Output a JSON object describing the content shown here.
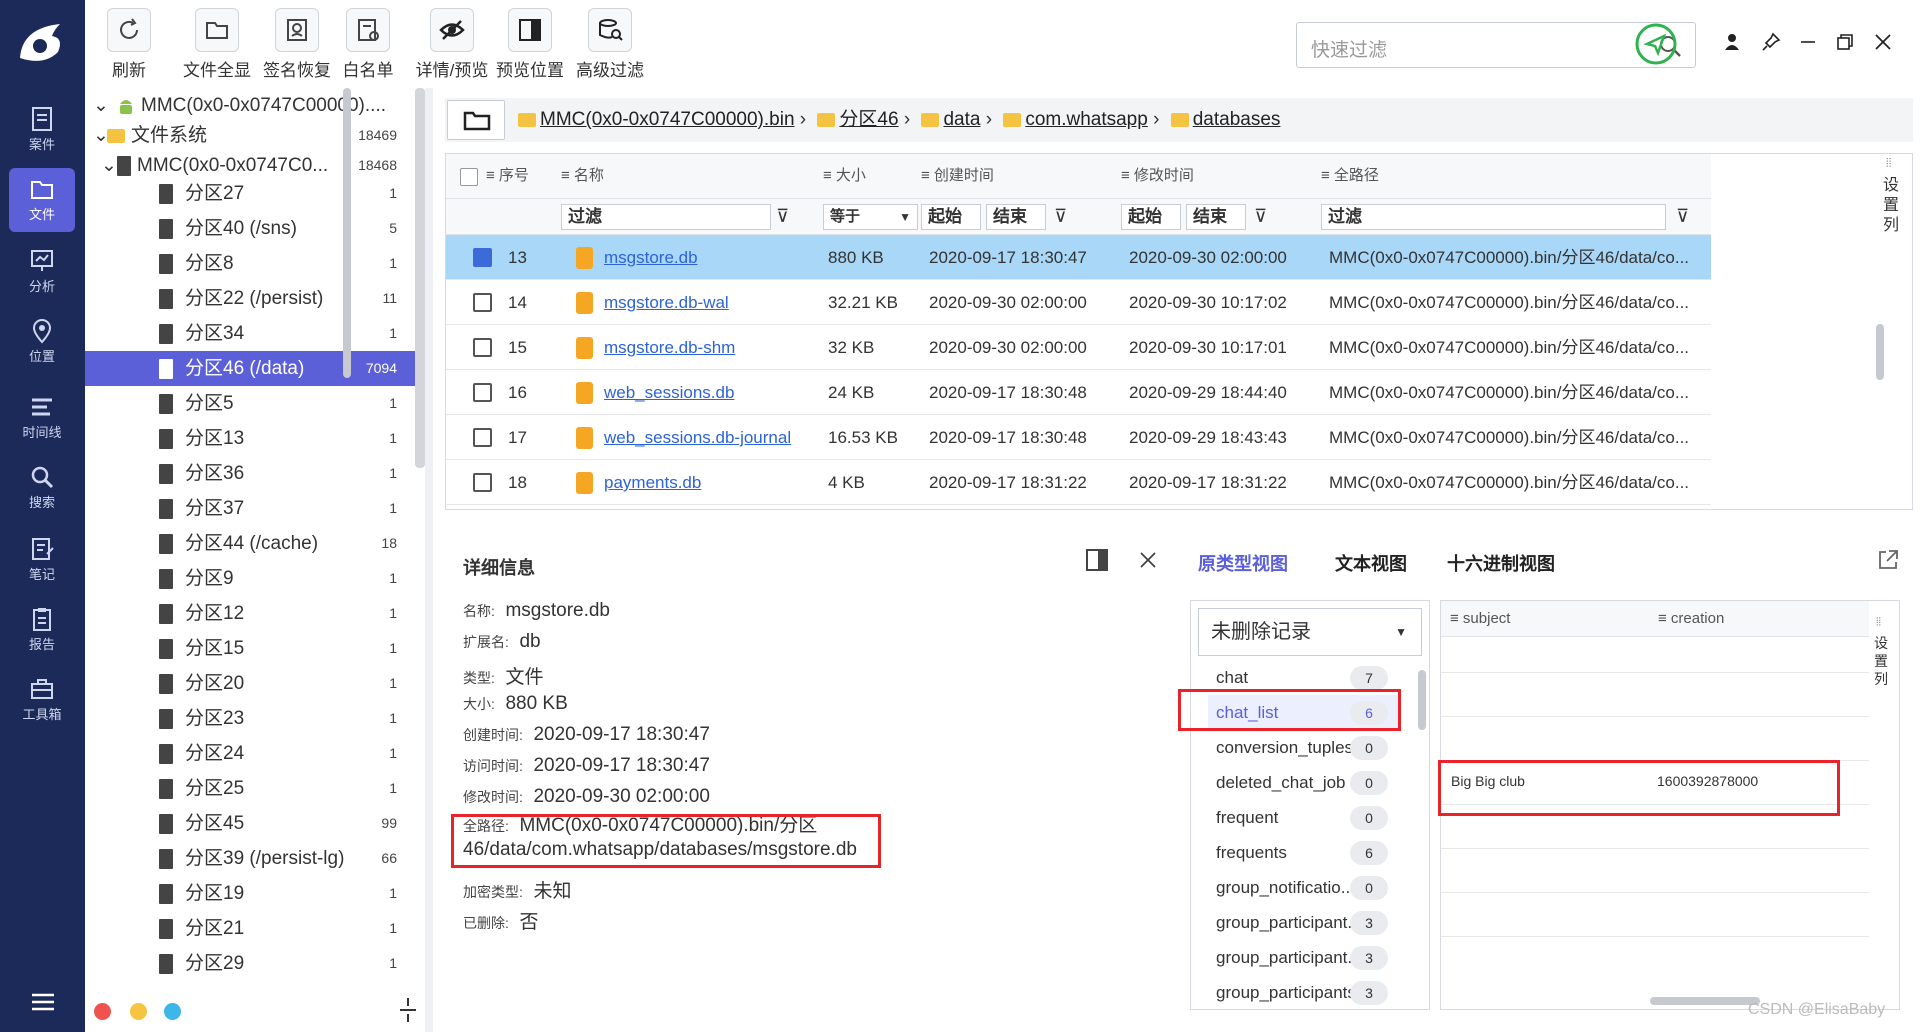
{
  "nav": {
    "items": [
      {
        "label": "案件",
        "icon": "case-icon"
      },
      {
        "label": "文件",
        "icon": "file-icon"
      },
      {
        "label": "分析",
        "icon": "analysis-icon"
      },
      {
        "label": "位置",
        "icon": "location-icon"
      },
      {
        "label": "时间线",
        "icon": "timeline-icon"
      },
      {
        "label": "搜索",
        "icon": "search-icon"
      },
      {
        "label": "笔记",
        "icon": "note-icon"
      },
      {
        "label": "报告",
        "icon": "report-icon"
      },
      {
        "label": "工具箱",
        "icon": "toolbox-icon"
      }
    ],
    "active": "文件"
  },
  "toolbar": {
    "buttons": [
      "刷新",
      "文件全显",
      "签名恢复",
      "白名单",
      "详情/预览",
      "预览位置",
      "高级过滤"
    ],
    "search_placeholder": "快速过滤"
  },
  "tree": {
    "root": {
      "label": "MMC(0x0-0x0747C00000)....",
      "count": ""
    },
    "fs": {
      "label": "文件系统",
      "count": "18469"
    },
    "mmc": {
      "label": "MMC(0x0-0x0747C0...",
      "count": "18468"
    },
    "items": [
      {
        "label": "分区27",
        "count": "1"
      },
      {
        "label": "分区40  (/sns)",
        "count": "5"
      },
      {
        "label": "分区8",
        "count": "1"
      },
      {
        "label": "分区22  (/persist)",
        "count": "11"
      },
      {
        "label": "分区34",
        "count": "1"
      },
      {
        "label": "分区46  (/data)",
        "count": "7094"
      },
      {
        "label": "分区5",
        "count": "1"
      },
      {
        "label": "分区13",
        "count": "1"
      },
      {
        "label": "分区36",
        "count": "1"
      },
      {
        "label": "分区37",
        "count": "1"
      },
      {
        "label": "分区44  (/cache)",
        "count": "18"
      },
      {
        "label": "分区9",
        "count": "1"
      },
      {
        "label": "分区12",
        "count": "1"
      },
      {
        "label": "分区15",
        "count": "1"
      },
      {
        "label": "分区20",
        "count": "1"
      },
      {
        "label": "分区23",
        "count": "1"
      },
      {
        "label": "分区24",
        "count": "1"
      },
      {
        "label": "分区25",
        "count": "1"
      },
      {
        "label": "分区45",
        "count": "99"
      },
      {
        "label": "分区39  (/persist-lg)",
        "count": "66"
      },
      {
        "label": "分区19",
        "count": "1"
      },
      {
        "label": "分区21",
        "count": "1"
      },
      {
        "label": "分区29",
        "count": "1"
      }
    ]
  },
  "breadcrumb": [
    "MMC(0x0-0x0747C00000).bin",
    "分区46",
    "data",
    "com.whatsapp",
    "databases"
  ],
  "grid": {
    "headers": [
      "序号",
      "名称",
      "大小",
      "创建时间",
      "修改时间",
      "全路径"
    ],
    "filters": {
      "name": "过滤",
      "size": "等于",
      "c_start": "起始",
      "c_end": "结束",
      "m_start": "起始",
      "m_end": "结束",
      "path": "过滤"
    },
    "settings_label": "设置列",
    "rows": [
      {
        "no": "13",
        "name": "msgstore.db",
        "size": "880 KB",
        "created": "2020-09-17 18:30:47",
        "modified": "2020-09-30 02:00:00",
        "path": "MMC(0x0-0x0747C00000).bin/分区46/data/co...",
        "checked": true
      },
      {
        "no": "14",
        "name": "msgstore.db-wal",
        "size": "32.21 KB",
        "created": "2020-09-30 02:00:00",
        "modified": "2020-09-30 10:17:02",
        "path": "MMC(0x0-0x0747C00000).bin/分区46/data/co...",
        "checked": false
      },
      {
        "no": "15",
        "name": "msgstore.db-shm",
        "size": "32 KB",
        "created": "2020-09-30 02:00:00",
        "modified": "2020-09-30 10:17:01",
        "path": "MMC(0x0-0x0747C00000).bin/分区46/data/co...",
        "checked": false
      },
      {
        "no": "16",
        "name": "web_sessions.db",
        "size": "24 KB",
        "created": "2020-09-17 18:30:48",
        "modified": "2020-09-29 18:44:40",
        "path": "MMC(0x0-0x0747C00000).bin/分区46/data/co...",
        "checked": false
      },
      {
        "no": "17",
        "name": "web_sessions.db-journal",
        "size": "16.53 KB",
        "created": "2020-09-17 18:30:48",
        "modified": "2020-09-29 18:43:43",
        "path": "MMC(0x0-0x0747C00000).bin/分区46/data/co...",
        "checked": false
      },
      {
        "no": "18",
        "name": "payments.db",
        "size": "4 KB",
        "created": "2020-09-17 18:31:22",
        "modified": "2020-09-17 18:31:22",
        "path": "MMC(0x0-0x0747C00000).bin/分区46/data/co...",
        "checked": false
      }
    ]
  },
  "detail": {
    "title": "详细信息",
    "fields": [
      {
        "label": "名称:",
        "value": "msgstore.db"
      },
      {
        "label": "扩展名:",
        "value": "db"
      },
      {
        "label": "类型:",
        "value": "文件"
      },
      {
        "label": "大小:",
        "value": "880 KB"
      },
      {
        "label": "创建时间:",
        "value": "2020-09-17 18:30:47"
      },
      {
        "label": "访问时间:",
        "value": "2020-09-17 18:30:47"
      },
      {
        "label": "修改时间:",
        "value": "2020-09-30 02:00:00"
      }
    ],
    "path_label": "全路径:",
    "path_line1": "MMC(0x0-0x0747C00000).bin/分区",
    "path_line2": "46/data/com.whatsapp/databases/msgstore.db",
    "enc_label": "加密类型:",
    "enc_value": "未知",
    "del_label": "已删除:",
    "del_value": "否"
  },
  "preview": {
    "tabs": [
      "原类型视图",
      "文本视图",
      "十六进制视图"
    ],
    "active_tab": "原类型视图",
    "select_value": "未删除记录",
    "tables": [
      {
        "name": "chat",
        "count": "7"
      },
      {
        "name": "chat_list",
        "count": "6"
      },
      {
        "name": "conversion_tuples",
        "count": "0"
      },
      {
        "name": "deleted_chat_job",
        "count": "0"
      },
      {
        "name": "frequent",
        "count": "0"
      },
      {
        "name": "frequents",
        "count": "6"
      },
      {
        "name": "group_notificatio...",
        "count": "0"
      },
      {
        "name": "group_participant...",
        "count": "3"
      },
      {
        "name": "group_participant...",
        "count": "3"
      },
      {
        "name": "group_participants",
        "count": "3"
      }
    ],
    "columns": [
      "subject",
      "creation"
    ],
    "record": {
      "subject": "Big Big club",
      "creation": "1600392878000"
    },
    "settings_label": "设置列"
  },
  "watermark": "CSDN @ElisaBaby",
  "colors": {
    "nav_bg": "#1c2a5a",
    "accent": "#5b5fd8",
    "selected_row": "#a8d7f8",
    "highlight_box": "#e8232a",
    "link": "#2d63d8"
  }
}
